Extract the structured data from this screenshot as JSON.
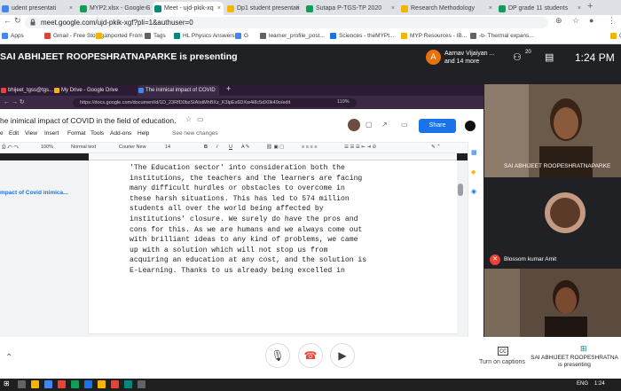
{
  "browser": {
    "tabs": [
      {
        "label": "udent presentati",
        "color": "#4285f4"
      },
      {
        "label": "MYP2.xlsx - Google Sh",
        "color": "#0f9d58"
      },
      {
        "label": "Meet - ujd-pkik-xq",
        "color": "#00897b",
        "active": true
      },
      {
        "label": "Dp1 student presentati",
        "color": "#f4b400"
      },
      {
        "label": "Sutapa P-TGS-TP 2020",
        "color": "#0f9d58"
      },
      {
        "label": "Research Methodology",
        "color": "#f4b400"
      },
      {
        "label": "DP grade 11 students",
        "color": "#0f9d58"
      }
    ],
    "url": "meet.google.com/ujd-pkik-xgf?pli=1&authuser=0",
    "bookmarks": [
      {
        "label": "Apps",
        "color": "#4285f4"
      },
      {
        "label": "Gmail - Free Storag...",
        "color": "#db4437"
      },
      {
        "label": "Imported From IE",
        "color": "#f4b400"
      },
      {
        "label": "Tags",
        "color": "#5f6368"
      },
      {
        "label": "HL Physics Answers",
        "color": "#00897b"
      },
      {
        "label": "G",
        "color": "#4285f4"
      },
      {
        "label": "learner_profile_post...",
        "color": "#5f6368"
      },
      {
        "label": "Sciences - theMYPt...",
        "color": "#1a73e8"
      },
      {
        "label": "MYP Resources - IB...",
        "color": "#f4b400"
      },
      {
        "label": "-b- Thermal expans...",
        "color": "#5f6368"
      },
      {
        "label": "Othe",
        "color": "#f4b400"
      }
    ]
  },
  "meet": {
    "presenting_banner": "SAI ABHIJEET ROOPESHRATNAPARKE is presenting",
    "top_participant": {
      "initial": "A",
      "line1": "Aarnav Vijaiyan ...",
      "line2": "and 14 more"
    },
    "participant_count": "20",
    "time": "1:24 PM",
    "participants": [
      {
        "name": "SAI ABHIJEET ROOPESHRATNAPARKE"
      },
      {
        "name": "Blossom kumar Amit"
      },
      {
        "name": ""
      }
    ],
    "captions_label": "Turn on captions",
    "presenting_label_1": "SAI ABHIJEET ROOPESHRATNA",
    "presenting_label_2": "is presenting"
  },
  "shared_screen": {
    "inner_tabs": [
      {
        "label": "bhijeet_tgss@tgs...",
        "color": "#ea4335"
      },
      {
        "label": "My Drive - Google Drive",
        "color": "#f4b400"
      },
      {
        "label": "The inimical impact of COVID",
        "color": "#4285f4",
        "active": true
      }
    ],
    "inner_url": "https://docs.google.com/document/d/1D_23RfD0bzSIAIstMhBXz_K3lpEx6DXw4i8c5dX0k49o/edit",
    "inner_zoom": "110%",
    "doc_title": "he inimical impact of COVID in the field of education.",
    "menus": [
      "e",
      "Edit",
      "View",
      "Insert",
      "Format",
      "Tools",
      "Add-ons",
      "Help"
    ],
    "see_changes": "See new changes",
    "share_label": "Share",
    "toolbar": {
      "zoom": "100%",
      "style": "Normal text",
      "font": "Courier New",
      "size": "14"
    },
    "outline_title": "mpact of Covid inimica...",
    "paragraph_lines": [
      "'The Education sector' into consideration both the",
      "institutions, the teachers and the learners are facing",
      "many difficult hurdles or obstacles to overcome in",
      "these harsh situations. This has led to 574 million",
      "students all over the world being affected by",
      "institutions' closure. We surely do have the pros and",
      "cons for this. As we are humans and we always come out",
      "with brilliant ideas to any kind of problems, we came",
      "up with a solution which will not stop us from",
      "acquiring an education at any cost, and the solution is",
      "E-Learning. Thanks to us already being excelled in"
    ]
  },
  "taskbar": {
    "lang": "ENG",
    "time_label": "1:24"
  }
}
